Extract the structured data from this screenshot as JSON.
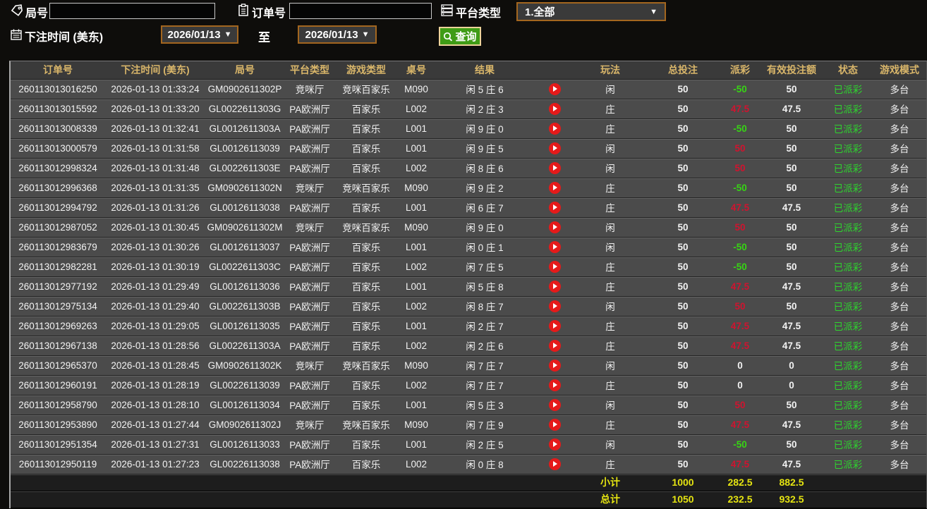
{
  "colors": {
    "header_gold": "#d9b66a",
    "win_red": "#d0132f",
    "loss_green": "#37d414",
    "status_green": "#2ed52e",
    "footer_yellow": "#e5e411",
    "play_red": "#e51a1a",
    "btn_green": "#3f9c16",
    "accent_orange_border": "#a3661f"
  },
  "icons": {
    "round_field": "tag-icon",
    "order_field": "clipboard-icon",
    "platform_field": "server-list-icon",
    "time_field": "calendar-icon",
    "query_button": "search-icon",
    "video": "play-icon",
    "dropdown_glyph": "▼"
  },
  "filters": {
    "round_label": "局号",
    "round_value": "",
    "order_label": "订单号",
    "order_value": "",
    "platform_label": "平台类型",
    "platform_value": "1.全部",
    "time_label": "下注时间 (美东)",
    "date_from": "2026/01/13",
    "to_label": "至",
    "date_to": "2026/01/13",
    "query_label": "查询"
  },
  "table": {
    "headers": [
      "订单号",
      "下注时间 (美东)",
      "局号",
      "平台类型",
      "游戏类型",
      "桌号",
      "结果",
      "",
      "玩法",
      "总投注",
      "派彩",
      "有效投注额",
      "状态",
      "游戏模式"
    ],
    "rows": [
      {
        "order_id": "260113013016250",
        "bet_time": "2026-01-13 01:33:24",
        "round_id": "GM0902611302P",
        "platform_type": "竞咪厅",
        "game_type": "竞咪百家乐",
        "table_no": "M090",
        "result": "闲 5 庄 6",
        "play_type": "闲",
        "total_bet": "50",
        "payout": "-50",
        "valid_bet": "50",
        "status": "已派彩",
        "game_mode": "多台"
      },
      {
        "order_id": "260113013015592",
        "bet_time": "2026-01-13 01:33:20",
        "round_id": "GL0022611303G",
        "platform_type": "PA欧洲厅",
        "game_type": "百家乐",
        "table_no": "L002",
        "result": "闲 2 庄 3",
        "play_type": "庄",
        "total_bet": "50",
        "payout": "47.5",
        "valid_bet": "47.5",
        "status": "已派彩",
        "game_mode": "多台"
      },
      {
        "order_id": "260113013008339",
        "bet_time": "2026-01-13 01:32:41",
        "round_id": "GL0012611303A",
        "platform_type": "PA欧洲厅",
        "game_type": "百家乐",
        "table_no": "L001",
        "result": "闲 9 庄 0",
        "play_type": "庄",
        "total_bet": "50",
        "payout": "-50",
        "valid_bet": "50",
        "status": "已派彩",
        "game_mode": "多台"
      },
      {
        "order_id": "260113013000579",
        "bet_time": "2026-01-13 01:31:58",
        "round_id": "GL00126113039",
        "platform_type": "PA欧洲厅",
        "game_type": "百家乐",
        "table_no": "L001",
        "result": "闲 9 庄 5",
        "play_type": "闲",
        "total_bet": "50",
        "payout": "50",
        "valid_bet": "50",
        "status": "已派彩",
        "game_mode": "多台"
      },
      {
        "order_id": "260113012998324",
        "bet_time": "2026-01-13 01:31:48",
        "round_id": "GL0022611303E",
        "platform_type": "PA欧洲厅",
        "game_type": "百家乐",
        "table_no": "L002",
        "result": "闲 8 庄 6",
        "play_type": "闲",
        "total_bet": "50",
        "payout": "50",
        "valid_bet": "50",
        "status": "已派彩",
        "game_mode": "多台"
      },
      {
        "order_id": "260113012996368",
        "bet_time": "2026-01-13 01:31:35",
        "round_id": "GM0902611302N",
        "platform_type": "竞咪厅",
        "game_type": "竞咪百家乐",
        "table_no": "M090",
        "result": "闲 9 庄 2",
        "play_type": "庄",
        "total_bet": "50",
        "payout": "-50",
        "valid_bet": "50",
        "status": "已派彩",
        "game_mode": "多台"
      },
      {
        "order_id": "260113012994792",
        "bet_time": "2026-01-13 01:31:26",
        "round_id": "GL00126113038",
        "platform_type": "PA欧洲厅",
        "game_type": "百家乐",
        "table_no": "L001",
        "result": "闲 6 庄 7",
        "play_type": "庄",
        "total_bet": "50",
        "payout": "47.5",
        "valid_bet": "47.5",
        "status": "已派彩",
        "game_mode": "多台"
      },
      {
        "order_id": "260113012987052",
        "bet_time": "2026-01-13 01:30:45",
        "round_id": "GM0902611302M",
        "platform_type": "竞咪厅",
        "game_type": "竞咪百家乐",
        "table_no": "M090",
        "result": "闲 9 庄 0",
        "play_type": "闲",
        "total_bet": "50",
        "payout": "50",
        "valid_bet": "50",
        "status": "已派彩",
        "game_mode": "多台"
      },
      {
        "order_id": "260113012983679",
        "bet_time": "2026-01-13 01:30:26",
        "round_id": "GL00126113037",
        "platform_type": "PA欧洲厅",
        "game_type": "百家乐",
        "table_no": "L001",
        "result": "闲 0 庄 1",
        "play_type": "闲",
        "total_bet": "50",
        "payout": "-50",
        "valid_bet": "50",
        "status": "已派彩",
        "game_mode": "多台"
      },
      {
        "order_id": "260113012982281",
        "bet_time": "2026-01-13 01:30:19",
        "round_id": "GL0022611303C",
        "platform_type": "PA欧洲厅",
        "game_type": "百家乐",
        "table_no": "L002",
        "result": "闲 7 庄 5",
        "play_type": "庄",
        "total_bet": "50",
        "payout": "-50",
        "valid_bet": "50",
        "status": "已派彩",
        "game_mode": "多台"
      },
      {
        "order_id": "260113012977192",
        "bet_time": "2026-01-13 01:29:49",
        "round_id": "GL00126113036",
        "platform_type": "PA欧洲厅",
        "game_type": "百家乐",
        "table_no": "L001",
        "result": "闲 5 庄 8",
        "play_type": "庄",
        "total_bet": "50",
        "payout": "47.5",
        "valid_bet": "47.5",
        "status": "已派彩",
        "game_mode": "多台"
      },
      {
        "order_id": "260113012975134",
        "bet_time": "2026-01-13 01:29:40",
        "round_id": "GL0022611303B",
        "platform_type": "PA欧洲厅",
        "game_type": "百家乐",
        "table_no": "L002",
        "result": "闲 8 庄 7",
        "play_type": "闲",
        "total_bet": "50",
        "payout": "50",
        "valid_bet": "50",
        "status": "已派彩",
        "game_mode": "多台"
      },
      {
        "order_id": "260113012969263",
        "bet_time": "2026-01-13 01:29:05",
        "round_id": "GL00126113035",
        "platform_type": "PA欧洲厅",
        "game_type": "百家乐",
        "table_no": "L001",
        "result": "闲 2 庄 7",
        "play_type": "庄",
        "total_bet": "50",
        "payout": "47.5",
        "valid_bet": "47.5",
        "status": "已派彩",
        "game_mode": "多台"
      },
      {
        "order_id": "260113012967138",
        "bet_time": "2026-01-13 01:28:56",
        "round_id": "GL0022611303A",
        "platform_type": "PA欧洲厅",
        "game_type": "百家乐",
        "table_no": "L002",
        "result": "闲 2 庄 6",
        "play_type": "庄",
        "total_bet": "50",
        "payout": "47.5",
        "valid_bet": "47.5",
        "status": "已派彩",
        "game_mode": "多台"
      },
      {
        "order_id": "260113012965370",
        "bet_time": "2026-01-13 01:28:45",
        "round_id": "GM0902611302K",
        "platform_type": "竞咪厅",
        "game_type": "竞咪百家乐",
        "table_no": "M090",
        "result": "闲 7 庄 7",
        "play_type": "闲",
        "total_bet": "50",
        "payout": "0",
        "valid_bet": "0",
        "status": "已派彩",
        "game_mode": "多台"
      },
      {
        "order_id": "260113012960191",
        "bet_time": "2026-01-13 01:28:19",
        "round_id": "GL00226113039",
        "platform_type": "PA欧洲厅",
        "game_type": "百家乐",
        "table_no": "L002",
        "result": "闲 7 庄 7",
        "play_type": "庄",
        "total_bet": "50",
        "payout": "0",
        "valid_bet": "0",
        "status": "已派彩",
        "game_mode": "多台"
      },
      {
        "order_id": "260113012958790",
        "bet_time": "2026-01-13 01:28:10",
        "round_id": "GL00126113034",
        "platform_type": "PA欧洲厅",
        "game_type": "百家乐",
        "table_no": "L001",
        "result": "闲 5 庄 3",
        "play_type": "闲",
        "total_bet": "50",
        "payout": "50",
        "valid_bet": "50",
        "status": "已派彩",
        "game_mode": "多台"
      },
      {
        "order_id": "260113012953890",
        "bet_time": "2026-01-13 01:27:44",
        "round_id": "GM0902611302J",
        "platform_type": "竞咪厅",
        "game_type": "竞咪百家乐",
        "table_no": "M090",
        "result": "闲 7 庄 9",
        "play_type": "庄",
        "total_bet": "50",
        "payout": "47.5",
        "valid_bet": "47.5",
        "status": "已派彩",
        "game_mode": "多台"
      },
      {
        "order_id": "260113012951354",
        "bet_time": "2026-01-13 01:27:31",
        "round_id": "GL00126113033",
        "platform_type": "PA欧洲厅",
        "game_type": "百家乐",
        "table_no": "L001",
        "result": "闲 2 庄 5",
        "play_type": "闲",
        "total_bet": "50",
        "payout": "-50",
        "valid_bet": "50",
        "status": "已派彩",
        "game_mode": "多台"
      },
      {
        "order_id": "260113012950119",
        "bet_time": "2026-01-13 01:27:23",
        "round_id": "GL00226113038",
        "platform_type": "PA欧洲厅",
        "game_type": "百家乐",
        "table_no": "L002",
        "result": "闲 0 庄 8",
        "play_type": "庄",
        "total_bet": "50",
        "payout": "47.5",
        "valid_bet": "47.5",
        "status": "已派彩",
        "game_mode": "多台"
      }
    ],
    "subtotal": {
      "label": "小计",
      "total_bet": "1000",
      "payout": "282.5",
      "valid_bet": "882.5"
    },
    "grand_total": {
      "label": "总计",
      "total_bet": "1050",
      "payout": "232.5",
      "valid_bet": "932.5"
    }
  }
}
